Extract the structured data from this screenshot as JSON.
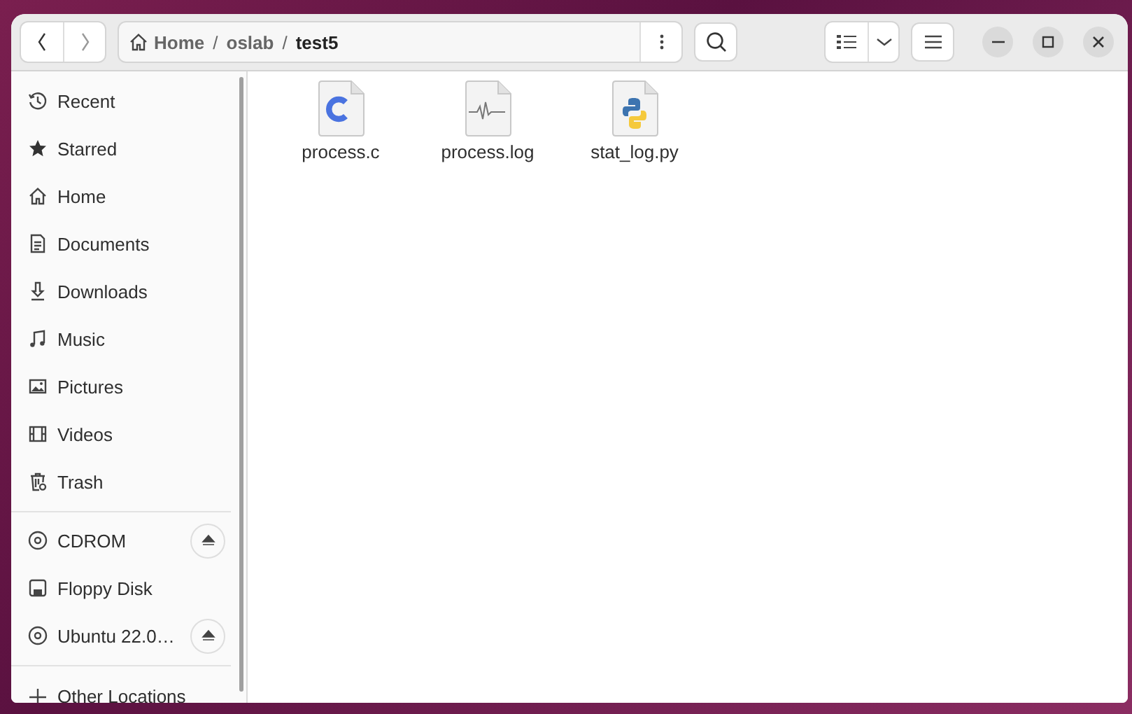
{
  "window": {
    "title_path": [
      {
        "label": "Home",
        "selected": false,
        "home": true
      },
      {
        "label": "oslab",
        "selected": false,
        "home": false
      },
      {
        "label": "test5",
        "selected": true,
        "home": false
      }
    ],
    "separator": "/"
  },
  "sidebar": {
    "sections": [
      [
        {
          "label": "Recent",
          "ejectable": false
        },
        {
          "label": "Starred",
          "ejectable": false
        },
        {
          "label": "Home",
          "ejectable": false
        },
        {
          "label": "Documents",
          "ejectable": false
        },
        {
          "label": "Downloads",
          "ejectable": false
        },
        {
          "label": "Music",
          "ejectable": false
        },
        {
          "label": "Pictures",
          "ejectable": false
        },
        {
          "label": "Videos",
          "ejectable": false
        },
        {
          "label": "Trash",
          "ejectable": false
        }
      ],
      [
        {
          "label": "CDROM",
          "ejectable": true
        },
        {
          "label": "Floppy Disk",
          "ejectable": false
        },
        {
          "label": "Ubuntu 22.0…",
          "ejectable": true
        }
      ],
      [
        {
          "label": "Other Locations",
          "ejectable": false
        }
      ]
    ]
  },
  "files": [
    {
      "name": "process.c",
      "kind": "c"
    },
    {
      "name": "process.log",
      "kind": "log"
    },
    {
      "name": "stat_log.py",
      "kind": "python"
    }
  ]
}
